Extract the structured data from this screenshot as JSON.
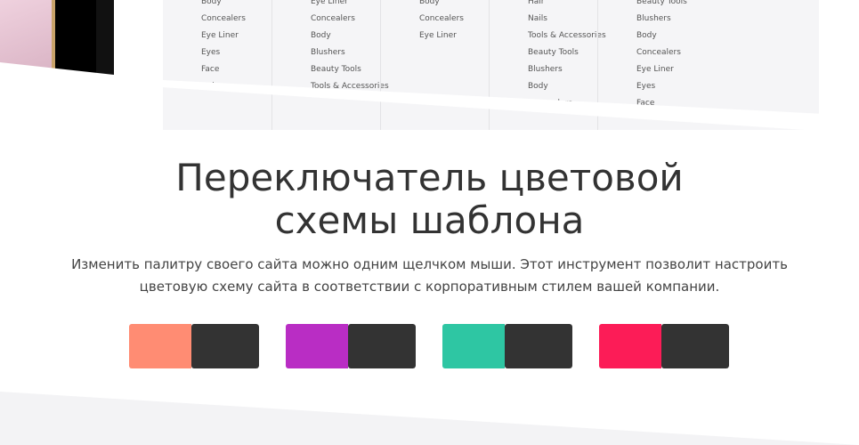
{
  "showcase": {
    "menu_columns": [
      [
        "Body",
        "Concealers",
        "Eye Liner",
        "Eyes",
        "Face",
        "Hair"
      ],
      [
        "Eye Liner",
        "Concealers",
        "Body",
        "Blushers",
        "Beauty Tools",
        "Tools & Accessories"
      ],
      [
        "Body",
        "Concealers",
        "Eye Liner"
      ],
      [
        "Hair",
        "Nails",
        "Tools & Accessories",
        "Beauty Tools",
        "Blushers",
        "Body",
        "Concealers"
      ],
      [
        "Beauty Tools",
        "Blushers",
        "Body",
        "Concealers",
        "Eye Liner",
        "Eyes",
        "Face"
      ]
    ]
  },
  "section": {
    "title_line1": "Переключатель цветовой",
    "title_line2": "схемы шаблона",
    "description": "Изменить палитру своего сайта можно одним щелчком мыши. Этот инструмент позволит настроить цветовую схему сайта в соответствии с корпоративным стилем вашей компании."
  },
  "color_schemes": [
    {
      "accent": "#ff8c73",
      "dark": "#333333"
    },
    {
      "accent": "#b92dc4",
      "dark": "#333333"
    },
    {
      "accent": "#2ec6a3",
      "dark": "#333333"
    },
    {
      "accent": "#fc1c57",
      "dark": "#333333"
    }
  ],
  "colors": {
    "background": "#ffffff",
    "bottom_band": "#f3f3f5"
  }
}
